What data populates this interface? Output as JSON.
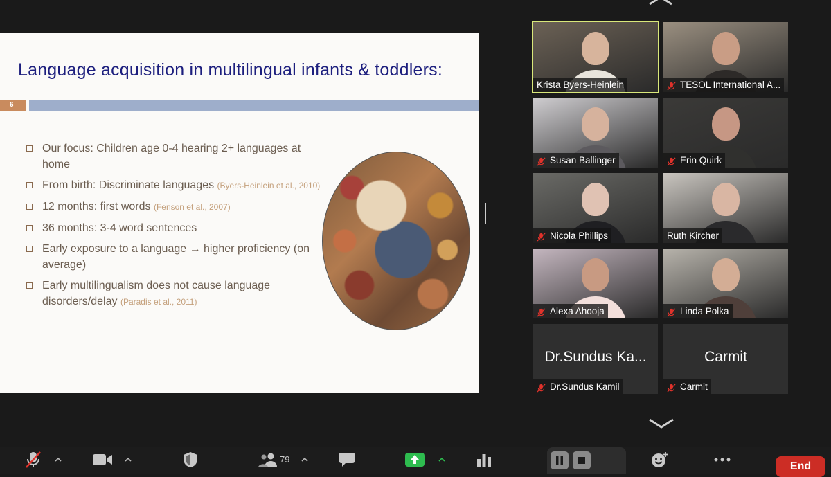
{
  "slide": {
    "title": "Language acquisition in multilingual infants & toddlers:",
    "number": "6",
    "bullets": [
      {
        "text": "Our focus: Children age 0-4 hearing 2+ languages at home",
        "cite": ""
      },
      {
        "text": "From birth: Discriminate languages",
        "cite": "(Byers-Heinlein et al., 2010)"
      },
      {
        "text": "12 months: first words",
        "cite": "(Fenson et al., 2007)"
      },
      {
        "text": "36 months: 3-4 word sentences",
        "cite": ""
      },
      {
        "text": "Early exposure to a language → higher proficiency (on average)",
        "cite": ""
      },
      {
        "text": "Early multilingualism does not cause language disorders/delay",
        "cite": "(Paradis et al., 2011)"
      }
    ]
  },
  "participants": [
    {
      "name": "Krista Byers-Heinlein",
      "muted": false,
      "active": true,
      "bg": "#6b6155",
      "skin": "#d7b49c",
      "shirt": "#e8e4dc"
    },
    {
      "name": "TESOL International A...",
      "muted": true,
      "active": false,
      "bg": "#9a8f80",
      "skin": "#c99d85",
      "shirt": "#2d2a28"
    },
    {
      "name": "Susan Ballinger",
      "muted": true,
      "active": false,
      "bg": "#cfcdd0",
      "skin": "#d6b29d",
      "shirt": "#5c5a5e"
    },
    {
      "name": "Erin Quirk",
      "muted": true,
      "active": false,
      "bg": "#3b3a38",
      "skin": "#c69784",
      "shirt": "#30302e"
    },
    {
      "name": "Nicola Phillips",
      "muted": true,
      "active": false,
      "bg": "#6a6a66",
      "skin": "#e0c2b3",
      "shirt": "#1f1f22"
    },
    {
      "name": "Ruth Kircher",
      "muted": false,
      "active": false,
      "bg": "#c9c5bf",
      "skin": "#d9b6a3",
      "shirt": "#2a2a2c"
    },
    {
      "name": "Alexa Ahooja",
      "muted": true,
      "active": false,
      "bg": "#c4b6bf",
      "skin": "#c89a82",
      "shirt": "#f3dfdb"
    },
    {
      "name": "Linda Polka",
      "muted": true,
      "active": false,
      "bg": "#b7b3ab",
      "skin": "#d3ad95",
      "shirt": "#4f3f3a"
    },
    {
      "name": "Dr.Sundus Kamil",
      "display": "Dr.Sundus Ka...",
      "muted": true,
      "video": false
    },
    {
      "name": "Carmit",
      "display": "Carmit",
      "muted": true,
      "video": false
    }
  ],
  "toolbar": {
    "participants_count": "79",
    "end_label": "End"
  },
  "colors": {
    "slide_title": "#1d1f7e",
    "active_border": "#d9e87a",
    "share_green": "#2ebc4f",
    "end_red": "#cc2d25"
  }
}
